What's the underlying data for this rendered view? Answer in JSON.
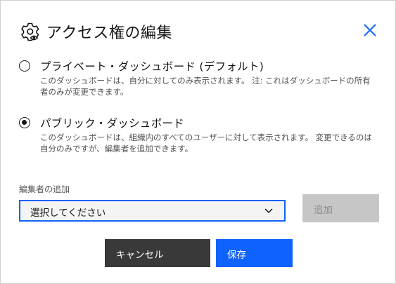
{
  "dialog": {
    "title": "アクセス権の編集",
    "title_icon": "gear-eye-icon",
    "close_icon": "close-icon"
  },
  "options": [
    {
      "label": "プライベート・ダッシュボード (デフォルト)",
      "description": "このダッシュボードは、自分に対してのみ表示されます。 注: これはダッシュボードの所有者のみが変更できます。",
      "selected": false
    },
    {
      "label": "パブリック・ダッシュボード",
      "description": "このダッシュボードは、組織内のすべてのユーザーに対して表示されます。 変更できるのは自分のみですが、編集者を追加できます。",
      "selected": true
    }
  ],
  "editors": {
    "label": "編集者の追加",
    "select_value": "選択してください",
    "add_label": "追加"
  },
  "footer": {
    "cancel_label": "キャンセル",
    "save_label": "保存"
  },
  "colors": {
    "primary": "#0f62fe",
    "secondary": "#393939",
    "disabled": "#c6c6c6"
  }
}
